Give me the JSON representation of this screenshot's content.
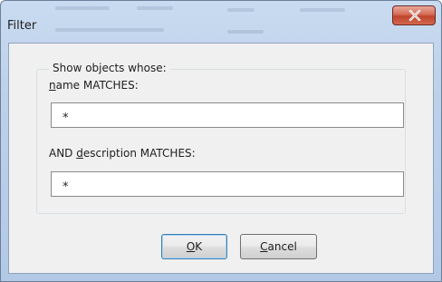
{
  "window": {
    "title": "Filter",
    "close_icon": "close-icon"
  },
  "group": {
    "legend": "Show objects whose:",
    "name_label_mnemonic": "n",
    "name_label_rest": "ame MATCHES:",
    "name_value": "*",
    "desc_label_prefix": "AND ",
    "desc_label_mnemonic": "d",
    "desc_label_rest": "escription MATCHES:",
    "desc_value": "*"
  },
  "buttons": {
    "ok_mnemonic": "O",
    "ok_rest": "K",
    "cancel_mnemonic": "C",
    "cancel_rest": "ancel"
  }
}
